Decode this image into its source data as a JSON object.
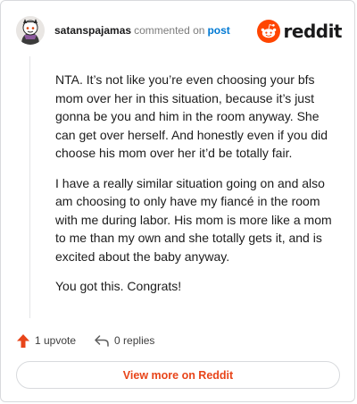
{
  "header": {
    "username": "satanspajamas",
    "action": "commented on",
    "post_link": "post",
    "brand": "reddit",
    "avatar_icon": "snoo-avatar-icon",
    "logo_icon": "reddit-alien-icon",
    "brand_color": "#ff4500"
  },
  "comment": {
    "paragraphs": [
      "NTA. It’s not like you’re even choosing your bfs mom over her in this situation, because it’s just gonna be you and him in the room anyway. She can get over herself. And honestly even if you did choose his mom over her it’d be totally fair.",
      "I have a really similar situation going on and also am choosing to only have my fiancé in the room with me during labor. His mom is more like a mom to me than my own and she totally gets it, and is excited about the baby anyway.",
      "You got this. Congrats!"
    ]
  },
  "footer": {
    "upvotes": "1 upvote",
    "replies": "0 replies",
    "upvote_icon": "upvote-arrow-icon",
    "reply_icon": "reply-arrow-icon"
  },
  "cta": {
    "label": "View more on Reddit"
  }
}
